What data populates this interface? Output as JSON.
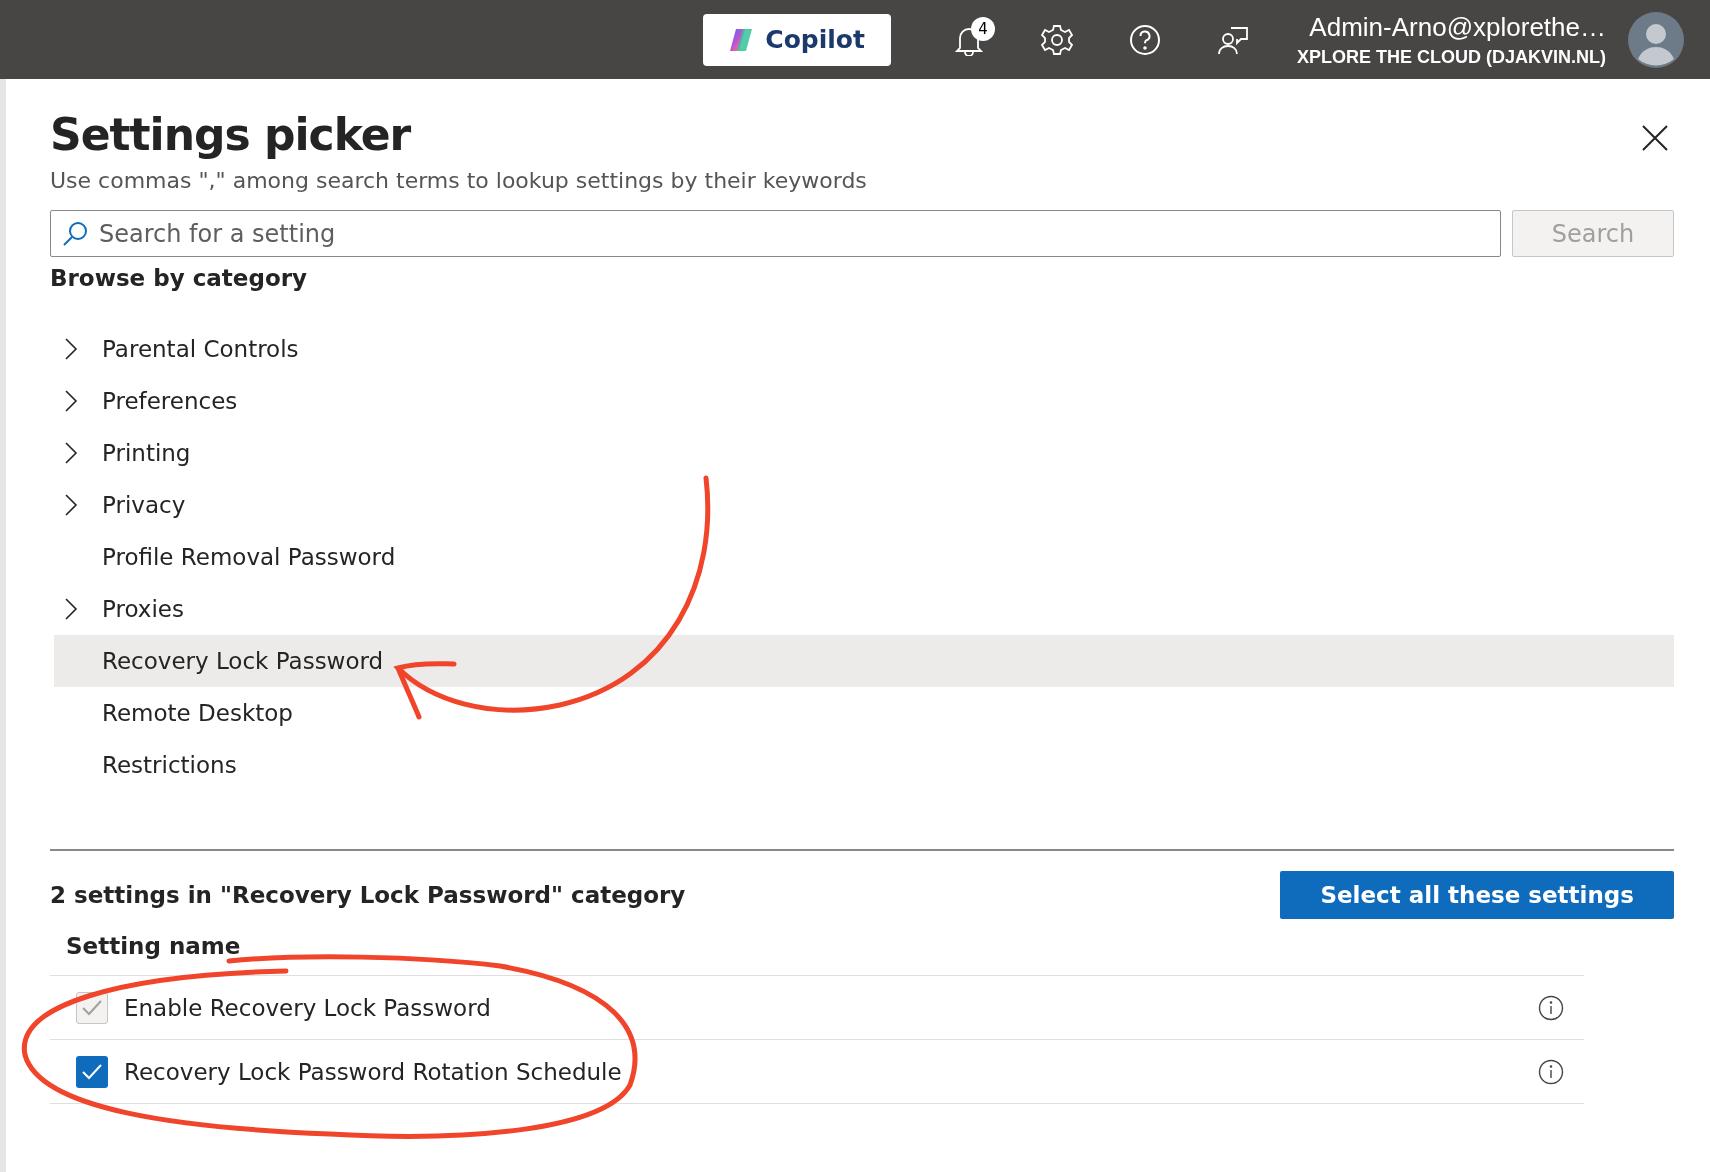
{
  "top_bar": {
    "copilot_label": "Copilot",
    "notification_count": "4",
    "user_name": "Admin-Arno@xplorethe…",
    "tenant": "XPLORE THE CLOUD (DJAKVIN.NL)"
  },
  "panel": {
    "title": "Settings picker",
    "subtitle": "Use commas \",\" among search terms to lookup settings by their keywords",
    "search": {
      "placeholder": "Search for a setting",
      "button": "Search"
    },
    "browse_heading": "Browse by category",
    "categories": [
      {
        "label": "Parental Controls",
        "expandable": true,
        "selected": false
      },
      {
        "label": "Preferences",
        "expandable": true,
        "selected": false
      },
      {
        "label": "Printing",
        "expandable": true,
        "selected": false
      },
      {
        "label": "Privacy",
        "expandable": true,
        "selected": false
      },
      {
        "label": "Profile Removal Password",
        "expandable": false,
        "selected": false
      },
      {
        "label": "Proxies",
        "expandable": true,
        "selected": false
      },
      {
        "label": "Recovery Lock Password",
        "expandable": false,
        "selected": true
      },
      {
        "label": "Remote Desktop",
        "expandable": false,
        "selected": false
      },
      {
        "label": "Restrictions",
        "expandable": false,
        "selected": false
      }
    ],
    "results_heading": "2 settings in \"Recovery Lock Password\" category",
    "select_all_button": "Select all these settings",
    "column_header": "Setting name",
    "settings": [
      {
        "name": "Enable Recovery Lock Password",
        "checked": true,
        "disabled": true
      },
      {
        "name": "Recovery Lock Password Rotation Schedule",
        "checked": true,
        "disabled": false
      }
    ]
  }
}
